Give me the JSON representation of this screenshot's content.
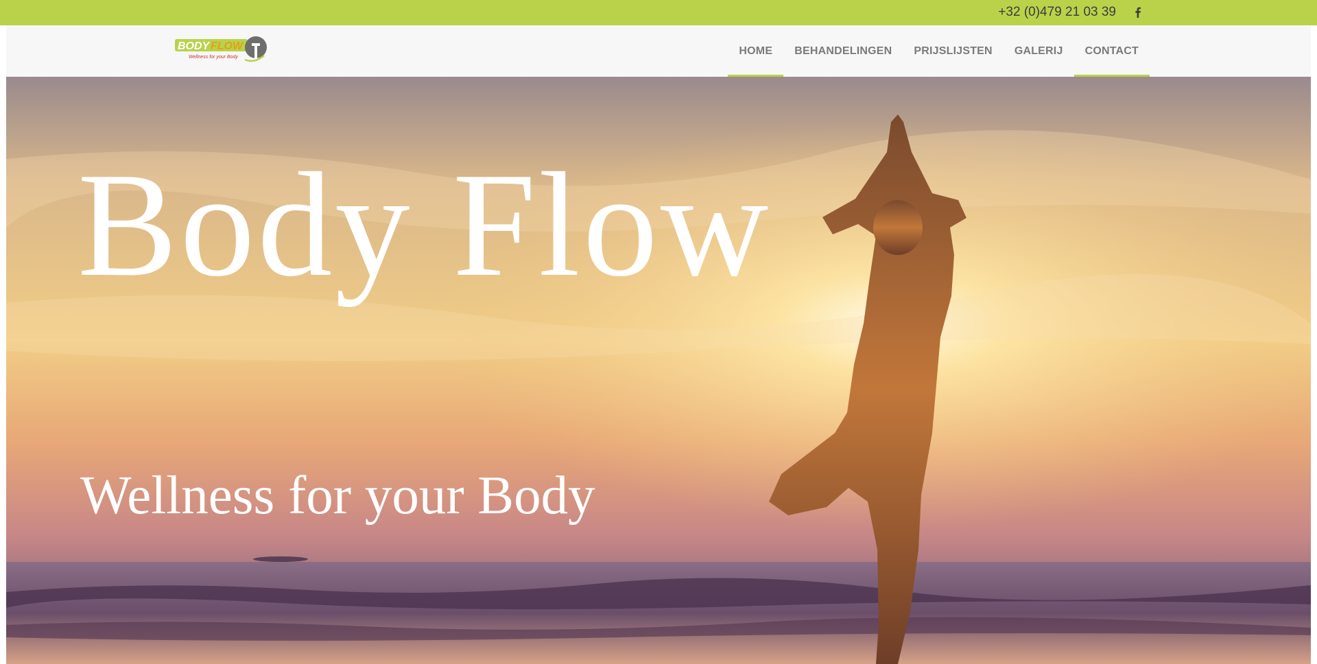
{
  "topbar": {
    "phone": "+32 (0)479 21 03 39",
    "social_icon": "facebook-icon",
    "bg_color": "#b9d24a"
  },
  "logo": {
    "brand_text": "BODY FLOW",
    "tagline": "Wellness for your Body"
  },
  "nav": {
    "items": [
      {
        "label": "HOME",
        "active": true
      },
      {
        "label": "BEHANDELINGEN",
        "active": false
      },
      {
        "label": "PRIJSLIJSTEN",
        "active": false
      },
      {
        "label": "GALERIJ",
        "active": false
      },
      {
        "label": "CONTACT",
        "active": true
      }
    ]
  },
  "hero": {
    "title": "Body Flow",
    "subtitle": "Wellness for your Body"
  },
  "colors": {
    "accent": "#b9d24a",
    "nav_text": "#7a7a7a",
    "hero_text": "#ffffff"
  }
}
